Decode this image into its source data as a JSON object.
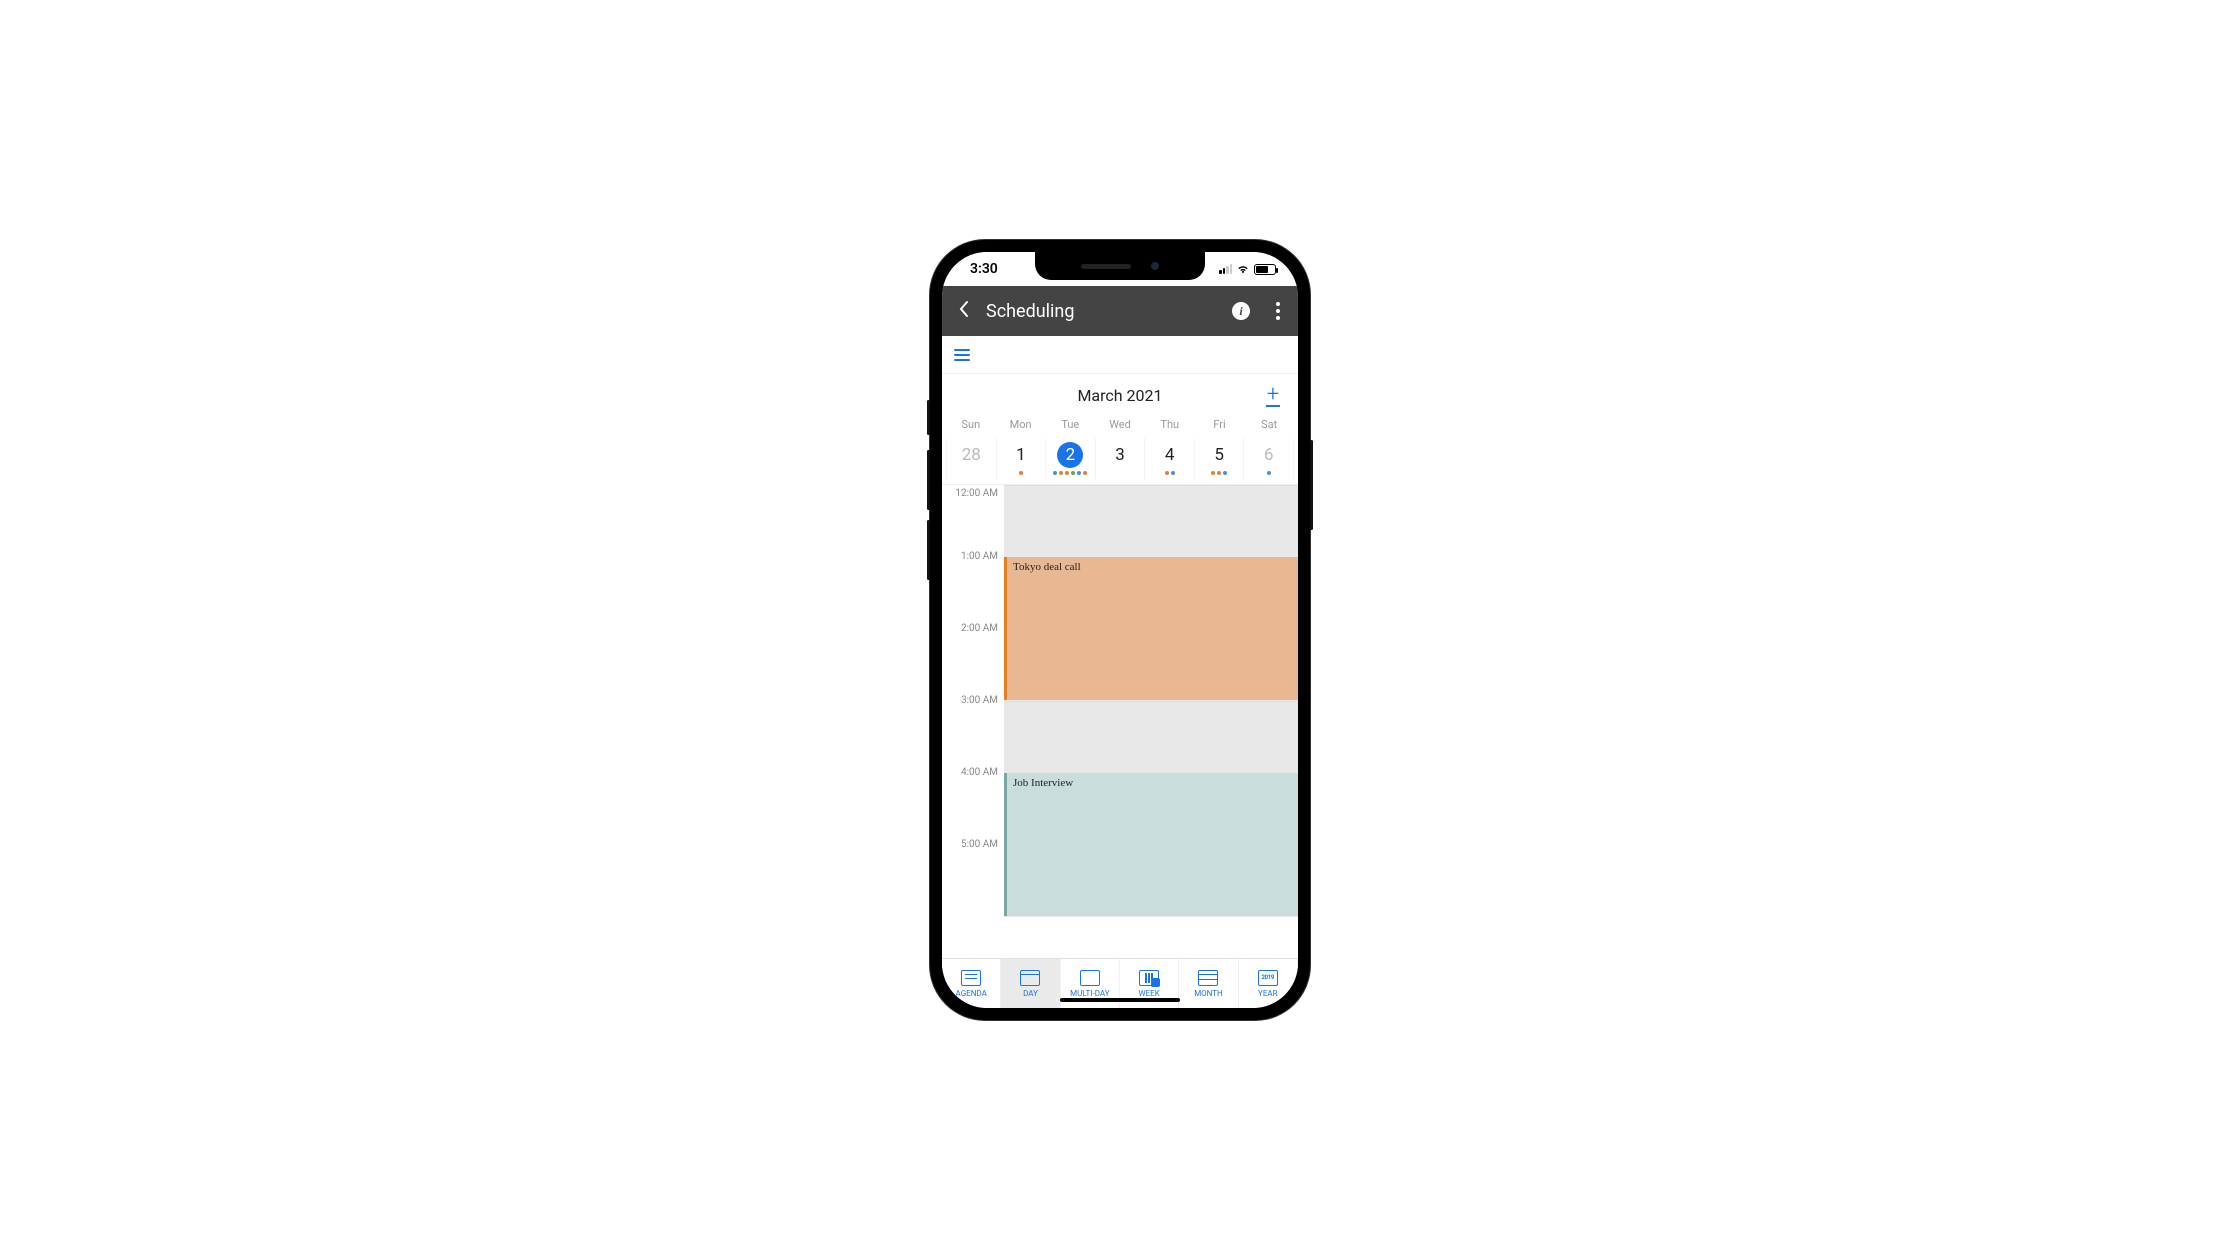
{
  "status": {
    "time": "3:30"
  },
  "appbar": {
    "title": "Scheduling"
  },
  "calendar": {
    "title": "March 2021",
    "dow": [
      "Sun",
      "Mon",
      "Tue",
      "Wed",
      "Thu",
      "Fri",
      "Sat"
    ],
    "days": [
      "28",
      "1",
      "2",
      "3",
      "4",
      "5",
      "6"
    ],
    "selectedIndex": 2
  },
  "hours": [
    "12:00 AM",
    "1:00 AM",
    "2:00 AM",
    "3:00 AM",
    "4:00 AM",
    "5:00 AM"
  ],
  "events": [
    {
      "title": "Tokyo deal call",
      "startHour": 1,
      "endHour": 3,
      "color": "orange"
    },
    {
      "title": "Job Interview",
      "startHour": 4,
      "endHour": 6,
      "color": "teal"
    }
  ],
  "tabs": {
    "labels": [
      "AGENDA",
      "DAY",
      "MULTI-DAY",
      "WEEK",
      "MONTH",
      "YEAR"
    ],
    "yearIconText": "2019",
    "selectedIndex": 1
  }
}
